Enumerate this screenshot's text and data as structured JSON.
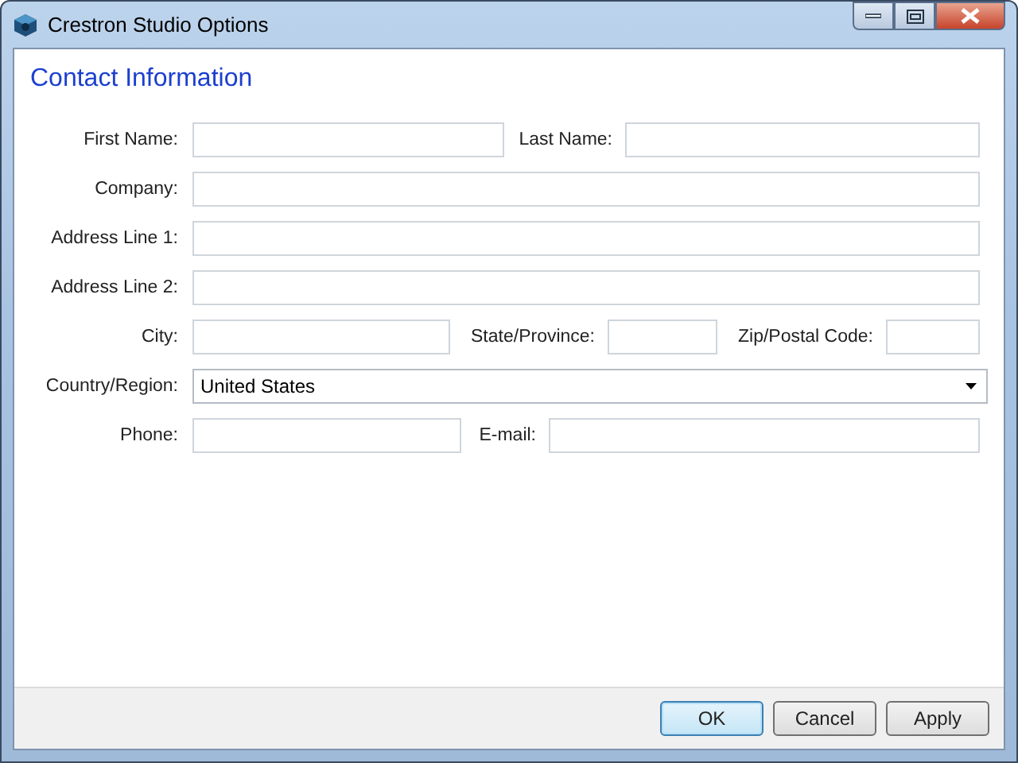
{
  "window": {
    "title": "Crestron Studio Options"
  },
  "section": {
    "title": "Contact Information"
  },
  "rows": [
    {
      "fields": [
        {
          "kind": "text",
          "label": "First Name:"
        },
        {
          "kind": "text",
          "label": "Last Name:"
        }
      ]
    },
    {
      "fields": [
        {
          "kind": "text",
          "label": "Company:"
        }
      ]
    },
    {
      "fields": [
        {
          "kind": "text",
          "label": "Address Line 1:"
        }
      ]
    },
    {
      "fields": [
        {
          "kind": "text",
          "label": "Address Line 2:"
        }
      ]
    },
    {
      "fields": [
        {
          "kind": "text",
          "label": "City:"
        },
        {
          "kind": "text",
          "label": "State/Province:"
        },
        {
          "kind": "text",
          "label": "Zip/Postal Code:"
        }
      ]
    },
    {
      "fields": [
        {
          "kind": "dropdown",
          "label": "Country/Region:",
          "value": "United States"
        }
      ]
    },
    {
      "fields": [
        {
          "kind": "text",
          "label": "Phone:"
        },
        {
          "kind": "text",
          "label": "E-mail:"
        }
      ]
    }
  ],
  "buttons": [
    {
      "label": "OK",
      "default": true
    },
    {
      "label": "Cancel",
      "default": false
    },
    {
      "label": "Apply",
      "default": false
    }
  ]
}
